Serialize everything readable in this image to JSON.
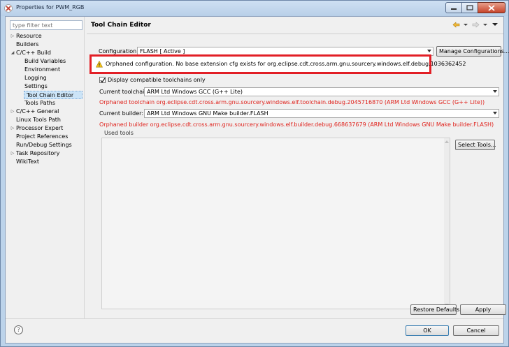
{
  "window": {
    "title": "Properties for PWM_RGB"
  },
  "filter": {
    "placeholder": "type filter text"
  },
  "tree": [
    {
      "label": "Resource",
      "expander": "▷",
      "indent": 0
    },
    {
      "label": "Builders",
      "expander": "",
      "indent": 0
    },
    {
      "label": "C/C++ Build",
      "expander": "◢",
      "indent": 0
    },
    {
      "label": "Build Variables",
      "expander": "",
      "indent": 1
    },
    {
      "label": "Environment",
      "expander": "",
      "indent": 1
    },
    {
      "label": "Logging",
      "expander": "",
      "indent": 1
    },
    {
      "label": "Settings",
      "expander": "",
      "indent": 1
    },
    {
      "label": "Tool Chain Editor",
      "expander": "",
      "indent": 1,
      "selected": true
    },
    {
      "label": "Tools Paths",
      "expander": "",
      "indent": 1
    },
    {
      "label": "C/C++ General",
      "expander": "▷",
      "indent": 0
    },
    {
      "label": "Linux Tools Path",
      "expander": "",
      "indent": 0
    },
    {
      "label": "Processor Expert",
      "expander": "▷",
      "indent": 0
    },
    {
      "label": "Project References",
      "expander": "",
      "indent": 0
    },
    {
      "label": "Run/Debug Settings",
      "expander": "",
      "indent": 0
    },
    {
      "label": "Task Repository",
      "expander": "▷",
      "indent": 0
    },
    {
      "label": "WikiText",
      "expander": "",
      "indent": 0
    }
  ],
  "page": {
    "title": "Tool Chain Editor",
    "configuration_label": "Configuration:",
    "configuration_value": "FLASH  [ Active ]",
    "manage_button": "Manage Configurations...",
    "warning": "Orphaned configuration. No base extension cfg exists for org.eclipse.cdt.cross.arm.gnu.sourcery.windows.elf.debug.1036362452",
    "compatible_checkbox": "Display compatible toolchains only",
    "compatible_checked": true,
    "toolchain_label": "Current toolchain:",
    "toolchain_value": "ARM Ltd Windows GCC (G++ Lite)",
    "toolchain_error": "Orphaned toolchain org.eclipse.cdt.cross.arm.gnu.sourcery.windows.elf.toolchain.debug.2045716870 (ARM Ltd Windows GCC (G++ Lite))",
    "builder_label": "Current builder:",
    "builder_value": "ARM Ltd Windows GNU Make builder.FLASH",
    "builder_error": "Orphaned builder org.eclipse.cdt.cross.arm.gnu.sourcery.windows.elf.builder.debug.668637679 (ARM Ltd Windows GNU Make builder.FLASH)",
    "used_tools_label": "Used tools",
    "select_tools_button": "Select Tools...",
    "restore_button": "Restore Defaults",
    "apply_button": "Apply"
  },
  "dialog": {
    "ok_button": "OK",
    "cancel_button": "Cancel",
    "help": "?"
  },
  "colors": {
    "error": "#e0221c",
    "highlight_border": "#e21f26",
    "selection": "#cce4f7"
  }
}
